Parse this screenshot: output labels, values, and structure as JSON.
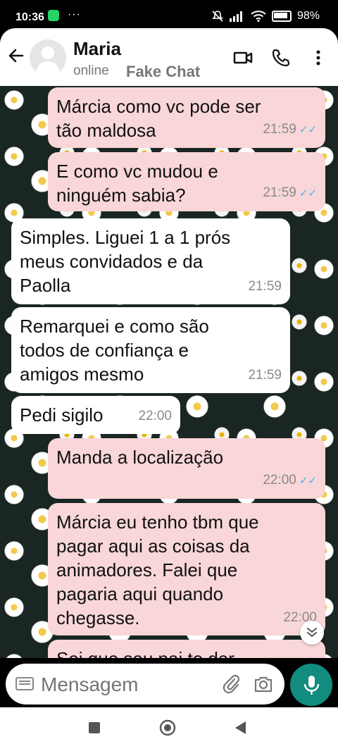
{
  "status_bar": {
    "time": "10:36",
    "overflow": "···",
    "battery": "98%",
    "icons": [
      "whatsapp-icon",
      "mute-icon",
      "signal-icon",
      "wifi-icon",
      "battery-icon"
    ]
  },
  "header": {
    "contact_name": "Maria",
    "status": "online",
    "watermark": "Fake Chat",
    "icons": [
      "back-arrow-icon",
      "avatar",
      "video-call-icon",
      "voice-call-icon",
      "more-icon"
    ]
  },
  "messages": [
    {
      "dir": "out",
      "text": "Márcia como vc pode ser tão maldosa",
      "time": "21:59",
      "ticks": "✓✓"
    },
    {
      "dir": "out",
      "text": "E como vc mudou e ninguém sabia?",
      "time": "21:59",
      "ticks": "✓✓"
    },
    {
      "dir": "in",
      "text": "Simples. Liguei 1 a 1 prós meus convidados e da Paolla",
      "time": "21:59"
    },
    {
      "dir": "in",
      "text": "Remarquei e como são todos de confiança e amigos mesmo",
      "time": "21:59"
    },
    {
      "dir": "in",
      "text": "Pedi sigilo",
      "time": "22:00"
    },
    {
      "dir": "out",
      "text": "Manda a localização",
      "time": "22:00",
      "ticks": "✓✓"
    },
    {
      "dir": "out",
      "text": "Márcia eu tenho tbm que pagar aqui as coisas da animadores. Falei que pagaria aqui quando chegasse.",
      "time": "22:00"
    },
    {
      "dir": "out",
      "text": "Sei que seu pai te dar"
    }
  ],
  "composer": {
    "placeholder": "Mensagem",
    "icons": [
      "keyboard-icon",
      "attach-icon",
      "camera-icon",
      "mic-icon"
    ]
  },
  "colors": {
    "outgoing_bubble": "#f9d6d8",
    "incoming_bubble": "#ffffff",
    "read_ticks": "#4fb3e8",
    "mic_button": "#128c7e"
  }
}
